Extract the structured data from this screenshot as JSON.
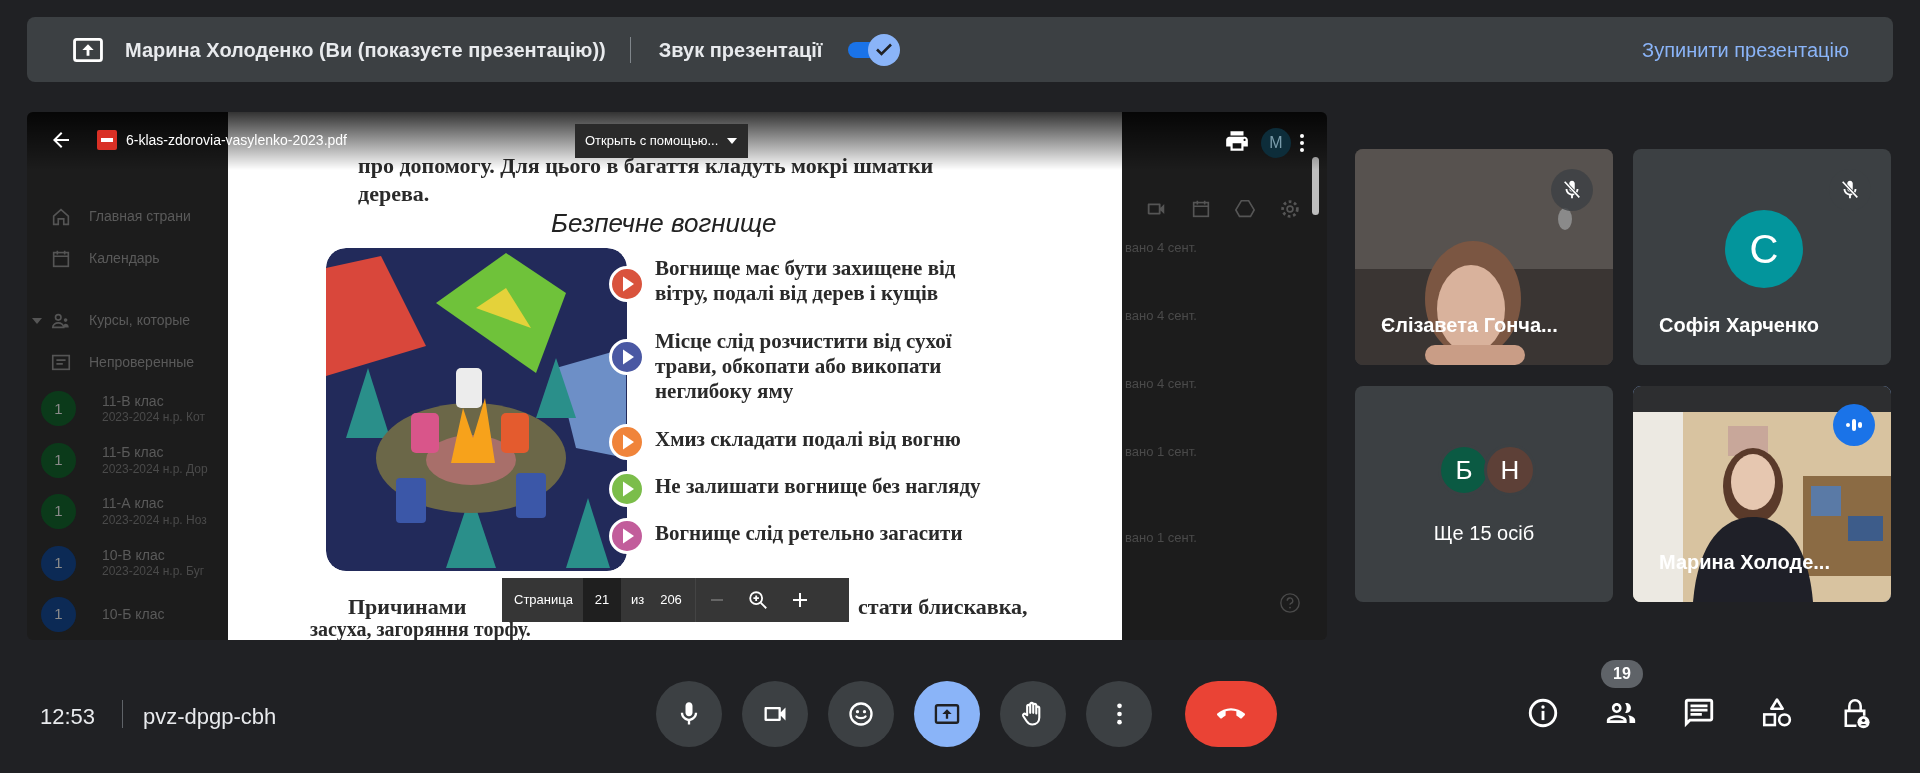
{
  "presenting_bar": {
    "presenter": "Марина Холоденко (Ви (показуєте презентацію))",
    "audio_label": "Звук презентації",
    "audio_on": true,
    "stop_link": "Зупинити презентацію"
  },
  "shared_screen": {
    "viewer": {
      "file_name": "6-klas-zdorovia-vasylenko-2023.pdf",
      "open_with": "Открыть с помощью...",
      "account_initial": "M"
    },
    "background_app": {
      "nav_items": [
        {
          "kind": "home",
          "label": "Главная страни"
        },
        {
          "kind": "calendar",
          "label": "Календарь"
        },
        {
          "kind": "people",
          "label": "Курсы, которые"
        },
        {
          "kind": "folder",
          "label": "Непроверенные"
        }
      ],
      "courses": [
        {
          "initial": "1",
          "name": "11-В клас",
          "subtitle": "2023-2024 н.р. Кот",
          "color": "#0b3a1a"
        },
        {
          "initial": "1",
          "name": "11-Б клас",
          "subtitle": "2023-2024 н.р. Дор",
          "color": "#0b3a1a"
        },
        {
          "initial": "1",
          "name": "11-А клас",
          "subtitle": "2023-2024 н.р. Ноз",
          "color": "#0b3a1a"
        },
        {
          "initial": "1",
          "name": "10-В клас",
          "subtitle": "2023-2024 н.р. Буг",
          "color": "#0c2a55"
        },
        {
          "initial": "1",
          "name": "10-Б клас",
          "color": "#0c2a55"
        }
      ],
      "dates": [
        "вано 4 сент.",
        "вано 4 сент.",
        "вано 4 сент.",
        "вано 1 сент.",
        "вано 1 сент."
      ]
    },
    "page": {
      "intro": "про допомогу. Для цього в багаття кладуть мокрі шматки\nдерева.",
      "heading": "Безпечне вогнище",
      "bullets": [
        {
          "text": "Вогнище має бути захищене від\nвітру, подалі від дерев і кущів",
          "color": "#d9533d"
        },
        {
          "text": "Місце слід розчистити від сухої\nтрави, обкопати або викопати\nнеглибоку яму",
          "color": "#4a58a3"
        },
        {
          "text": "Хмиз складати подалі від вогню",
          "color": "#f0843a"
        },
        {
          "text": "Не залишати вогнище без нагляду",
          "color": "#7bbd4a"
        },
        {
          "text": "Вогнище слід ретельно загасити",
          "color": "#c25d9b"
        }
      ],
      "outro_start": "Причинами",
      "outro_end": "стати блискавка,",
      "outro_line2": "засуха, загоряння торфу."
    },
    "page_toolbar": {
      "label": "Страница",
      "page": "21",
      "of": "из",
      "total": "206"
    }
  },
  "tiles": [
    {
      "kind": "video",
      "name": "Єлізавета Гонча...",
      "muted": true,
      "speaking": false
    },
    {
      "kind": "avatar",
      "initial": "С",
      "color": "#03959c",
      "name": "Софія Харченко",
      "muted": true,
      "speaking": false
    },
    {
      "kind": "more",
      "initials": [
        {
          "letter": "Б",
          "color": "#0b5a43"
        },
        {
          "letter": "Н",
          "color": "#5d4037"
        }
      ],
      "name": "Ще 15 осіб",
      "muted": false,
      "speaking": false
    },
    {
      "kind": "video",
      "name": "Марина Холоде...",
      "muted": false,
      "speaking": true
    }
  ],
  "bottom_bar": {
    "time": "12:53",
    "meeting_code": "pvz-dpgp-cbh",
    "controls": [
      {
        "kind": "mic",
        "active": false
      },
      {
        "kind": "camera",
        "active": false
      },
      {
        "kind": "emoji",
        "active": false
      },
      {
        "kind": "present",
        "active": true
      },
      {
        "kind": "hand",
        "active": false
      },
      {
        "kind": "more",
        "active": false
      },
      {
        "kind": "hangup",
        "active": false
      }
    ],
    "side_buttons": [
      {
        "kind": "info"
      },
      {
        "kind": "people",
        "badge": "19"
      },
      {
        "kind": "chat"
      },
      {
        "kind": "activities"
      },
      {
        "kind": "lock"
      }
    ]
  }
}
